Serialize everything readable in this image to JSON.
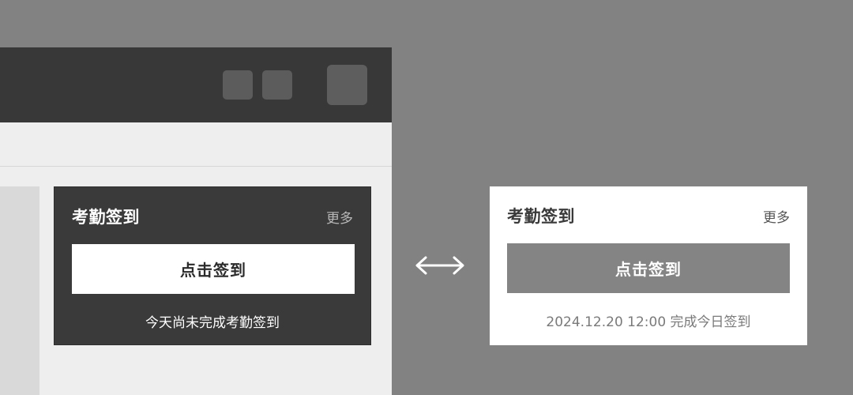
{
  "colors": {
    "background": "#828282",
    "dark_card": "#3a3a3a",
    "light_card": "#ffffff",
    "light_button": "#848484"
  },
  "dark_card": {
    "title": "考勤签到",
    "more": "更多",
    "button": "点击签到",
    "status": "今天尚未完成考勤签到"
  },
  "light_card": {
    "title": "考勤签到",
    "more": "更多",
    "button": "点击签到",
    "status": "2024.12.20 12:00 完成今日签到"
  },
  "icons": {
    "swap": "double-arrow-icon"
  }
}
